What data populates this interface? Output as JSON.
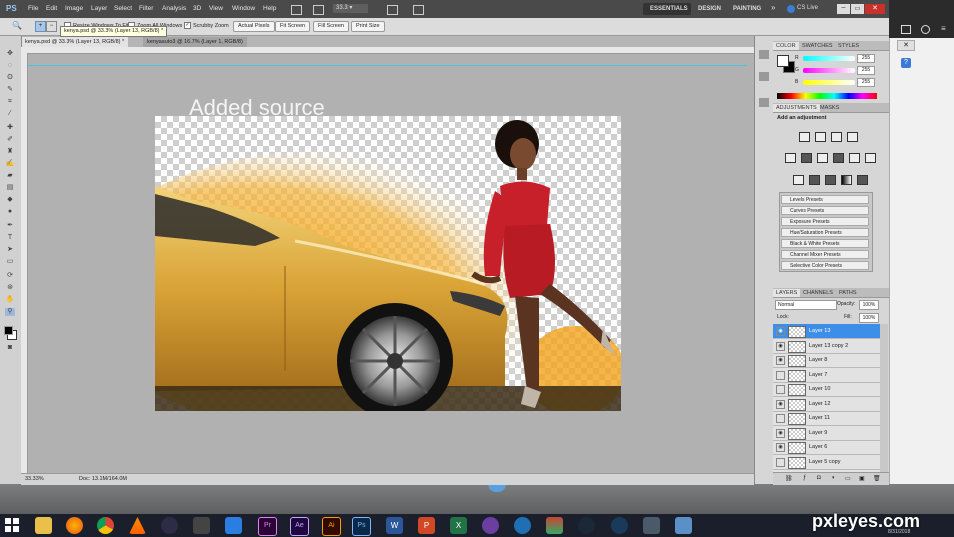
{
  "menu": {
    "logo": "PS",
    "items": [
      "File",
      "Edit",
      "Image",
      "Layer",
      "Select",
      "Filter",
      "Analysis",
      "3D",
      "View",
      "Window",
      "Help"
    ],
    "zoom_value": "33.3",
    "workspaces": [
      "ESSENTIALS",
      "DESIGN",
      "PAINTING"
    ],
    "more": "»",
    "cs_live": "CS Live"
  },
  "options": {
    "resize_windows": "Resize Windows To Fit",
    "zoom_all": "Zoom All Windows",
    "scrubby": "Scrubby Zoom",
    "buttons": [
      "Actual Pixels",
      "Fit Screen",
      "Fill Screen",
      "Print Size"
    ]
  },
  "tabs": {
    "active": "kenya.psd @ 33.3% (Layer 13, RGB/8) *",
    "second": "kenyaauto3 @ 16.7% (Layer 1, RGB/8)",
    "tooltip": "kenya.psd @ 33.3% (Layer 13, RGB/8) *"
  },
  "canvas": {
    "heading": "Added source"
  },
  "status": {
    "zoom": "33.33%",
    "doc": "Doc: 13.1M/164.0M"
  },
  "color_panel": {
    "tabs": [
      "COLOR",
      "SWATCHES",
      "STYLES"
    ],
    "channels": [
      {
        "label": "R",
        "value": "255",
        "color": "#e05050"
      },
      {
        "label": "G",
        "value": "255",
        "color": "#50d050"
      },
      {
        "label": "B",
        "value": "255",
        "color": "#5070e0"
      }
    ]
  },
  "adjustments": {
    "tabs": [
      "ADJUSTMENTS",
      "MASKS"
    ],
    "heading": "Add an adjustment",
    "presets": [
      "Levels Presets",
      "Curves Presets",
      "Exposure Presets",
      "Hue/Saturation Presets",
      "Black & White Presets",
      "Channel Mixer Presets",
      "Selective Color Presets"
    ]
  },
  "layers": {
    "tabs": [
      "LAYERS",
      "CHANNELS",
      "PATHS"
    ],
    "blend_mode": "Normal",
    "opacity_label": "Opacity:",
    "opacity": "100%",
    "lock_label": "Lock:",
    "fill_label": "Fill:",
    "fill": "100%",
    "items": [
      {
        "name": "Layer 13",
        "visible": true,
        "selected": true
      },
      {
        "name": "Layer 13 copy 2",
        "visible": true,
        "selected": false
      },
      {
        "name": "Layer 8",
        "visible": true,
        "selected": false
      },
      {
        "name": "Layer 7",
        "visible": false,
        "selected": false
      },
      {
        "name": "Layer 10",
        "visible": false,
        "selected": false
      },
      {
        "name": "Layer 12",
        "visible": true,
        "selected": false
      },
      {
        "name": "Layer 11",
        "visible": false,
        "selected": false
      },
      {
        "name": "Layer 9",
        "visible": true,
        "selected": false
      },
      {
        "name": "Layer 6",
        "visible": true,
        "selected": false
      },
      {
        "name": "Layer 5 copy",
        "visible": false,
        "selected": false
      }
    ]
  },
  "watermark": {
    "brand": "pxleyes.com",
    "date": "8/31/2018"
  },
  "colors": {
    "ps_dark": "#4a4a4a",
    "selected_layer": "#3d8ee8",
    "taskbar": "#1a1f2b",
    "car_gold": "#d9a336",
    "dress_red": "#c8202a"
  }
}
